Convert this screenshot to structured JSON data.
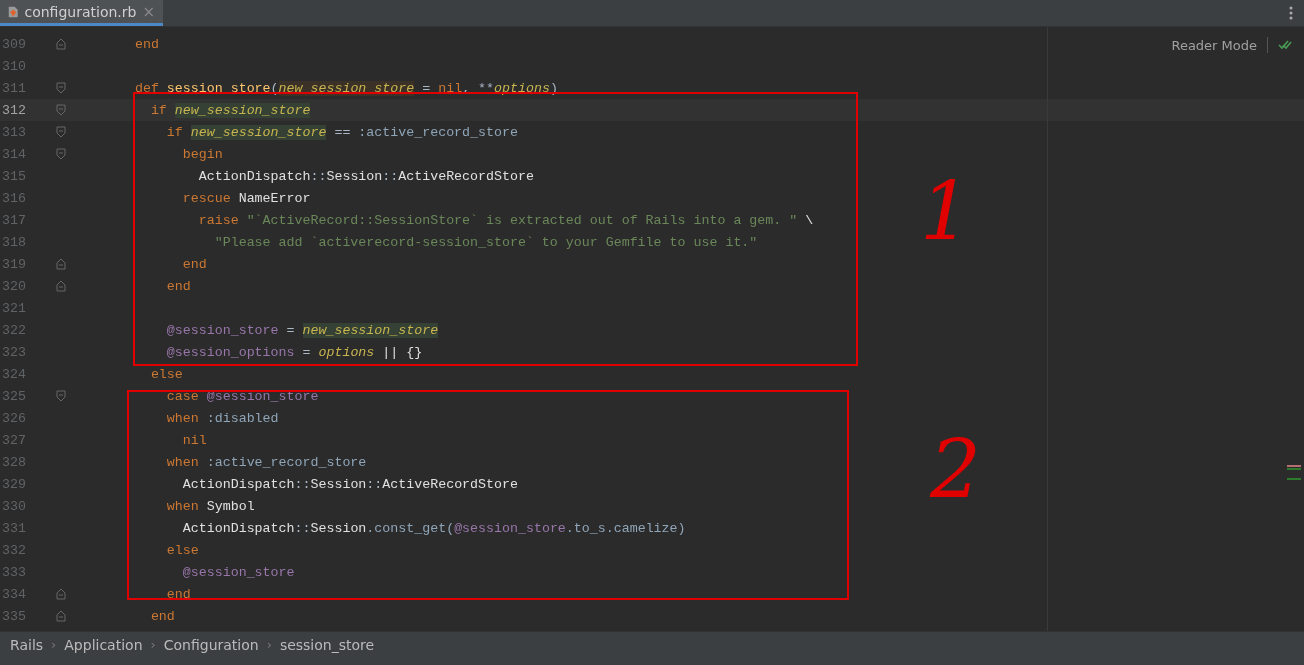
{
  "tab": {
    "title": "configuration.rb",
    "close": "×",
    "selected": true
  },
  "reader_mode": "Reader Mode",
  "lines": [
    {
      "number": "309",
      "current": false,
      "kind": "fold-end",
      "tokens": [
        {
          "text": "    end",
          "kind": "kw"
        }
      ]
    },
    {
      "number": "310",
      "current": false
    },
    {
      "number": "311",
      "current": false,
      "kind": "fold-start",
      "tokens": [
        {
          "text": "    def ",
          "kind": "kw"
        },
        {
          "text": "session_store",
          "kind": "method"
        },
        {
          "text": "(",
          "kind": "plain"
        },
        {
          "text": "new_session_store",
          "kind": "param-decl"
        },
        {
          "text": " = ",
          "kind": "plain"
        },
        {
          "text": "nil",
          "kind": "kw"
        },
        {
          "text": ", **",
          "kind": "plain"
        },
        {
          "text": "options",
          "kind": "param"
        },
        {
          "text": ")",
          "kind": "plain"
        }
      ]
    },
    {
      "number": "312",
      "current": true,
      "kind": "fold-start",
      "tokens": [
        {
          "text": "      if ",
          "kind": "kw"
        },
        {
          "text": "new_session_store",
          "kind": "param-usage"
        }
      ]
    },
    {
      "number": "313",
      "current": false,
      "kind": "fold-start",
      "tokens": [
        {
          "text": "        if ",
          "kind": "kw"
        },
        {
          "text": "new_session_store",
          "kind": "param-usage"
        },
        {
          "text": " == ",
          "kind": "plain"
        },
        {
          "text": ":active_record_store",
          "kind": "sym"
        }
      ]
    },
    {
      "number": "314",
      "current": false,
      "kind": "fold-start",
      "tokens": [
        {
          "text": "          begin",
          "kind": "kw"
        }
      ]
    },
    {
      "number": "315",
      "current": false,
      "tokens": [
        {
          "text": "            ActionDispatch",
          "kind": "const"
        },
        {
          "text": "::",
          "kind": "plain"
        },
        {
          "text": "Session",
          "kind": "const"
        },
        {
          "text": "::",
          "kind": "plain"
        },
        {
          "text": "ActiveRecordStore",
          "kind": "const"
        }
      ]
    },
    {
      "number": "316",
      "current": false,
      "tokens": [
        {
          "text": "          rescue ",
          "kind": "kw"
        },
        {
          "text": "NameError",
          "kind": "const"
        }
      ]
    },
    {
      "number": "317",
      "current": false,
      "tokens": [
        {
          "text": "            raise ",
          "kind": "kw"
        },
        {
          "text": "\"`ActiveRecord::SessionStore` is extracted out of Rails into a gem. \"",
          "kind": "str"
        },
        {
          "text": " \\",
          "kind": "const"
        }
      ]
    },
    {
      "number": "318",
      "current": false,
      "tokens": [
        {
          "text": "              \"Please add `activerecord-session_store` to your Gemfile to use it.\"",
          "kind": "str"
        }
      ]
    },
    {
      "number": "319",
      "current": false,
      "kind": "fold-end",
      "tokens": [
        {
          "text": "          end",
          "kind": "kw"
        }
      ]
    },
    {
      "number": "320",
      "current": false,
      "kind": "fold-end",
      "tokens": [
        {
          "text": "        end",
          "kind": "kw"
        }
      ]
    },
    {
      "number": "321",
      "current": false
    },
    {
      "number": "322",
      "current": false,
      "tokens": [
        {
          "text": "        @session_store",
          "kind": "ivar"
        },
        {
          "text": " = ",
          "kind": "plain"
        },
        {
          "text": "new_session_store",
          "kind": "param-usage"
        }
      ]
    },
    {
      "number": "323",
      "current": false,
      "tokens": [
        {
          "text": "        @session_options",
          "kind": "ivar"
        },
        {
          "text": " = ",
          "kind": "plain"
        },
        {
          "text": "options",
          "kind": "param"
        },
        {
          "text": " || {}",
          "kind": "const"
        }
      ]
    },
    {
      "number": "324",
      "current": false,
      "tokens": [
        {
          "text": "      else",
          "kind": "kw"
        }
      ]
    },
    {
      "number": "325",
      "current": false,
      "kind": "fold-start",
      "tokens": [
        {
          "text": "        case ",
          "kind": "kw"
        },
        {
          "text": "@session_store",
          "kind": "ivar"
        }
      ]
    },
    {
      "number": "326",
      "current": false,
      "tokens": [
        {
          "text": "        when ",
          "kind": "kw"
        },
        {
          "text": ":disabled",
          "kind": "sym"
        }
      ]
    },
    {
      "number": "327",
      "current": false,
      "tokens": [
        {
          "text": "          nil",
          "kind": "kw"
        }
      ]
    },
    {
      "number": "328",
      "current": false,
      "tokens": [
        {
          "text": "        when ",
          "kind": "kw"
        },
        {
          "text": ":active_record_store",
          "kind": "sym"
        }
      ]
    },
    {
      "number": "329",
      "current": false,
      "tokens": [
        {
          "text": "          ActionDispatch",
          "kind": "const"
        },
        {
          "text": "::",
          "kind": "plain"
        },
        {
          "text": "Session",
          "kind": "const"
        },
        {
          "text": "::",
          "kind": "plain"
        },
        {
          "text": "ActiveRecordStore",
          "kind": "const"
        }
      ]
    },
    {
      "number": "330",
      "current": false,
      "tokens": [
        {
          "text": "        when ",
          "kind": "kw"
        },
        {
          "text": "Symbol",
          "kind": "const"
        }
      ]
    },
    {
      "number": "331",
      "current": false,
      "tokens": [
        {
          "text": "          ActionDispatch",
          "kind": "const"
        },
        {
          "text": "::",
          "kind": "plain"
        },
        {
          "text": "Session",
          "kind": "const"
        },
        {
          "text": ".const_get(",
          "kind": "sym"
        },
        {
          "text": "@session_store",
          "kind": "ivar"
        },
        {
          "text": ".to_s.camelize)",
          "kind": "sym"
        }
      ]
    },
    {
      "number": "332",
      "current": false,
      "tokens": [
        {
          "text": "        else",
          "kind": "kw"
        }
      ]
    },
    {
      "number": "333",
      "current": false,
      "tokens": [
        {
          "text": "          @session_store",
          "kind": "ivar"
        }
      ]
    },
    {
      "number": "334",
      "current": false,
      "kind": "fold-end",
      "tokens": [
        {
          "text": "        end",
          "kind": "kw"
        }
      ]
    },
    {
      "number": "335",
      "current": false,
      "kind": "fold-end",
      "tokens": [
        {
          "text": "      end",
          "kind": "kw"
        }
      ]
    }
  ],
  "annotations": [
    {
      "label": "1"
    },
    {
      "label": "2"
    }
  ],
  "breadcrumbs": [
    "Rails",
    "Application",
    "Configuration",
    "session_store"
  ],
  "breadcrumb_separator": "›"
}
